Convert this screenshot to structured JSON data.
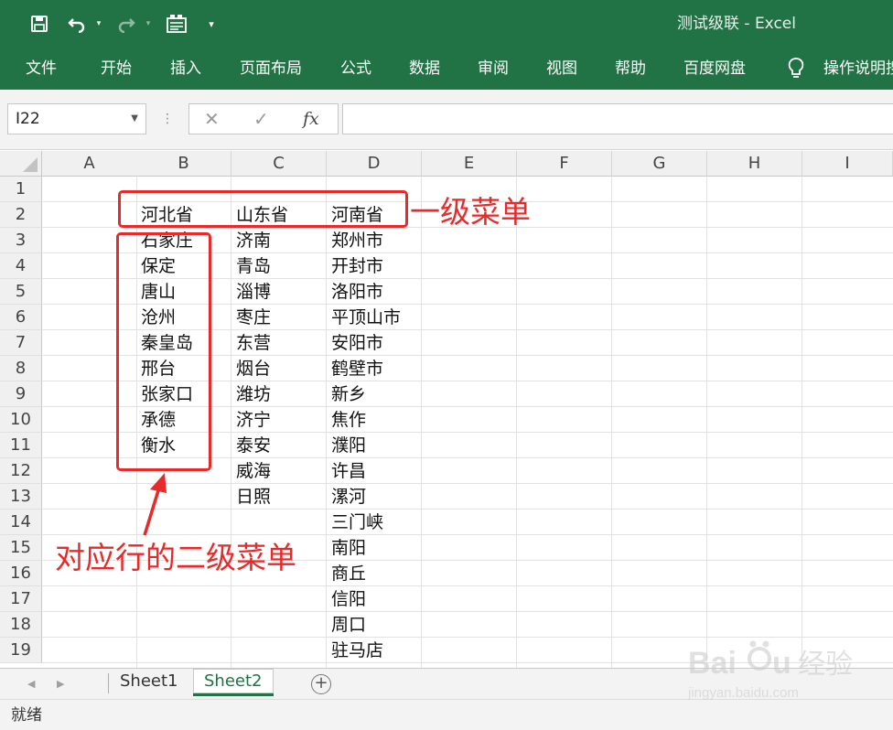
{
  "window": {
    "title": "测试级联  -  Excel",
    "accent": "#217346"
  },
  "quick_access": [
    "save-icon",
    "undo-icon",
    "redo-icon",
    "form-icon",
    "customize-icon"
  ],
  "ribbon_tabs": [
    "文件",
    "开始",
    "插入",
    "页面布局",
    "公式",
    "数据",
    "审阅",
    "视图",
    "帮助",
    "百度网盘",
    "操作说明搜索"
  ],
  "formula_bar": {
    "name_box": "I22",
    "fx": "fx",
    "formula": ""
  },
  "grid": {
    "columns": [
      "A",
      "B",
      "C",
      "D",
      "E",
      "F",
      "G",
      "H",
      "I"
    ],
    "rows": [
      "1",
      "2",
      "3",
      "4",
      "5",
      "6",
      "7",
      "8",
      "9",
      "10",
      "11",
      "12",
      "13",
      "14",
      "15",
      "16",
      "17",
      "18",
      "19"
    ],
    "cells": [
      {
        "ref": "B2",
        "value": "河北省"
      },
      {
        "ref": "C2",
        "value": "山东省"
      },
      {
        "ref": "D2",
        "value": "河南省"
      },
      {
        "ref": "B3",
        "value": "石家庄"
      },
      {
        "ref": "C3",
        "value": "济南"
      },
      {
        "ref": "D3",
        "value": "郑州市"
      },
      {
        "ref": "B4",
        "value": "保定"
      },
      {
        "ref": "C4",
        "value": "青岛"
      },
      {
        "ref": "D4",
        "value": "开封市"
      },
      {
        "ref": "B5",
        "value": "唐山"
      },
      {
        "ref": "C5",
        "value": "淄博"
      },
      {
        "ref": "D5",
        "value": "洛阳市"
      },
      {
        "ref": "B6",
        "value": "沧州"
      },
      {
        "ref": "C6",
        "value": "枣庄"
      },
      {
        "ref": "D6",
        "value": "平顶山市"
      },
      {
        "ref": "B7",
        "value": "秦皇岛"
      },
      {
        "ref": "C7",
        "value": "东营"
      },
      {
        "ref": "D7",
        "value": "安阳市"
      },
      {
        "ref": "B8",
        "value": "邢台"
      },
      {
        "ref": "C8",
        "value": "烟台"
      },
      {
        "ref": "D8",
        "value": "鹤壁市"
      },
      {
        "ref": "B9",
        "value": "张家口"
      },
      {
        "ref": "C9",
        "value": "潍坊"
      },
      {
        "ref": "D9",
        "value": "新乡"
      },
      {
        "ref": "B10",
        "value": "承德"
      },
      {
        "ref": "C10",
        "value": "济宁"
      },
      {
        "ref": "D10",
        "value": "焦作"
      },
      {
        "ref": "B11",
        "value": "衡水"
      },
      {
        "ref": "C11",
        "value": "泰安"
      },
      {
        "ref": "D11",
        "value": "濮阳"
      },
      {
        "ref": "C12",
        "value": "威海"
      },
      {
        "ref": "D12",
        "value": "许昌"
      },
      {
        "ref": "C13",
        "value": "日照"
      },
      {
        "ref": "D13",
        "value": "漯河"
      },
      {
        "ref": "D14",
        "value": "三门峡"
      },
      {
        "ref": "D15",
        "value": "南阳"
      },
      {
        "ref": "D16",
        "value": "商丘"
      },
      {
        "ref": "D17",
        "value": "信阳"
      },
      {
        "ref": "D18",
        "value": "周口"
      },
      {
        "ref": "D19",
        "value": "驻马店"
      }
    ]
  },
  "annotations": {
    "level1_label": "一级菜单",
    "level2_label": "对应行的二级菜单",
    "color": "#e82a2a"
  },
  "sheets": {
    "tabs": [
      "Sheet1",
      "Sheet2"
    ],
    "active": "Sheet2"
  },
  "status": {
    "text": "就绪"
  },
  "watermark": {
    "brand": "Baidu",
    "brand_cn": "经验",
    "url": "jingyan.baidu.com"
  }
}
